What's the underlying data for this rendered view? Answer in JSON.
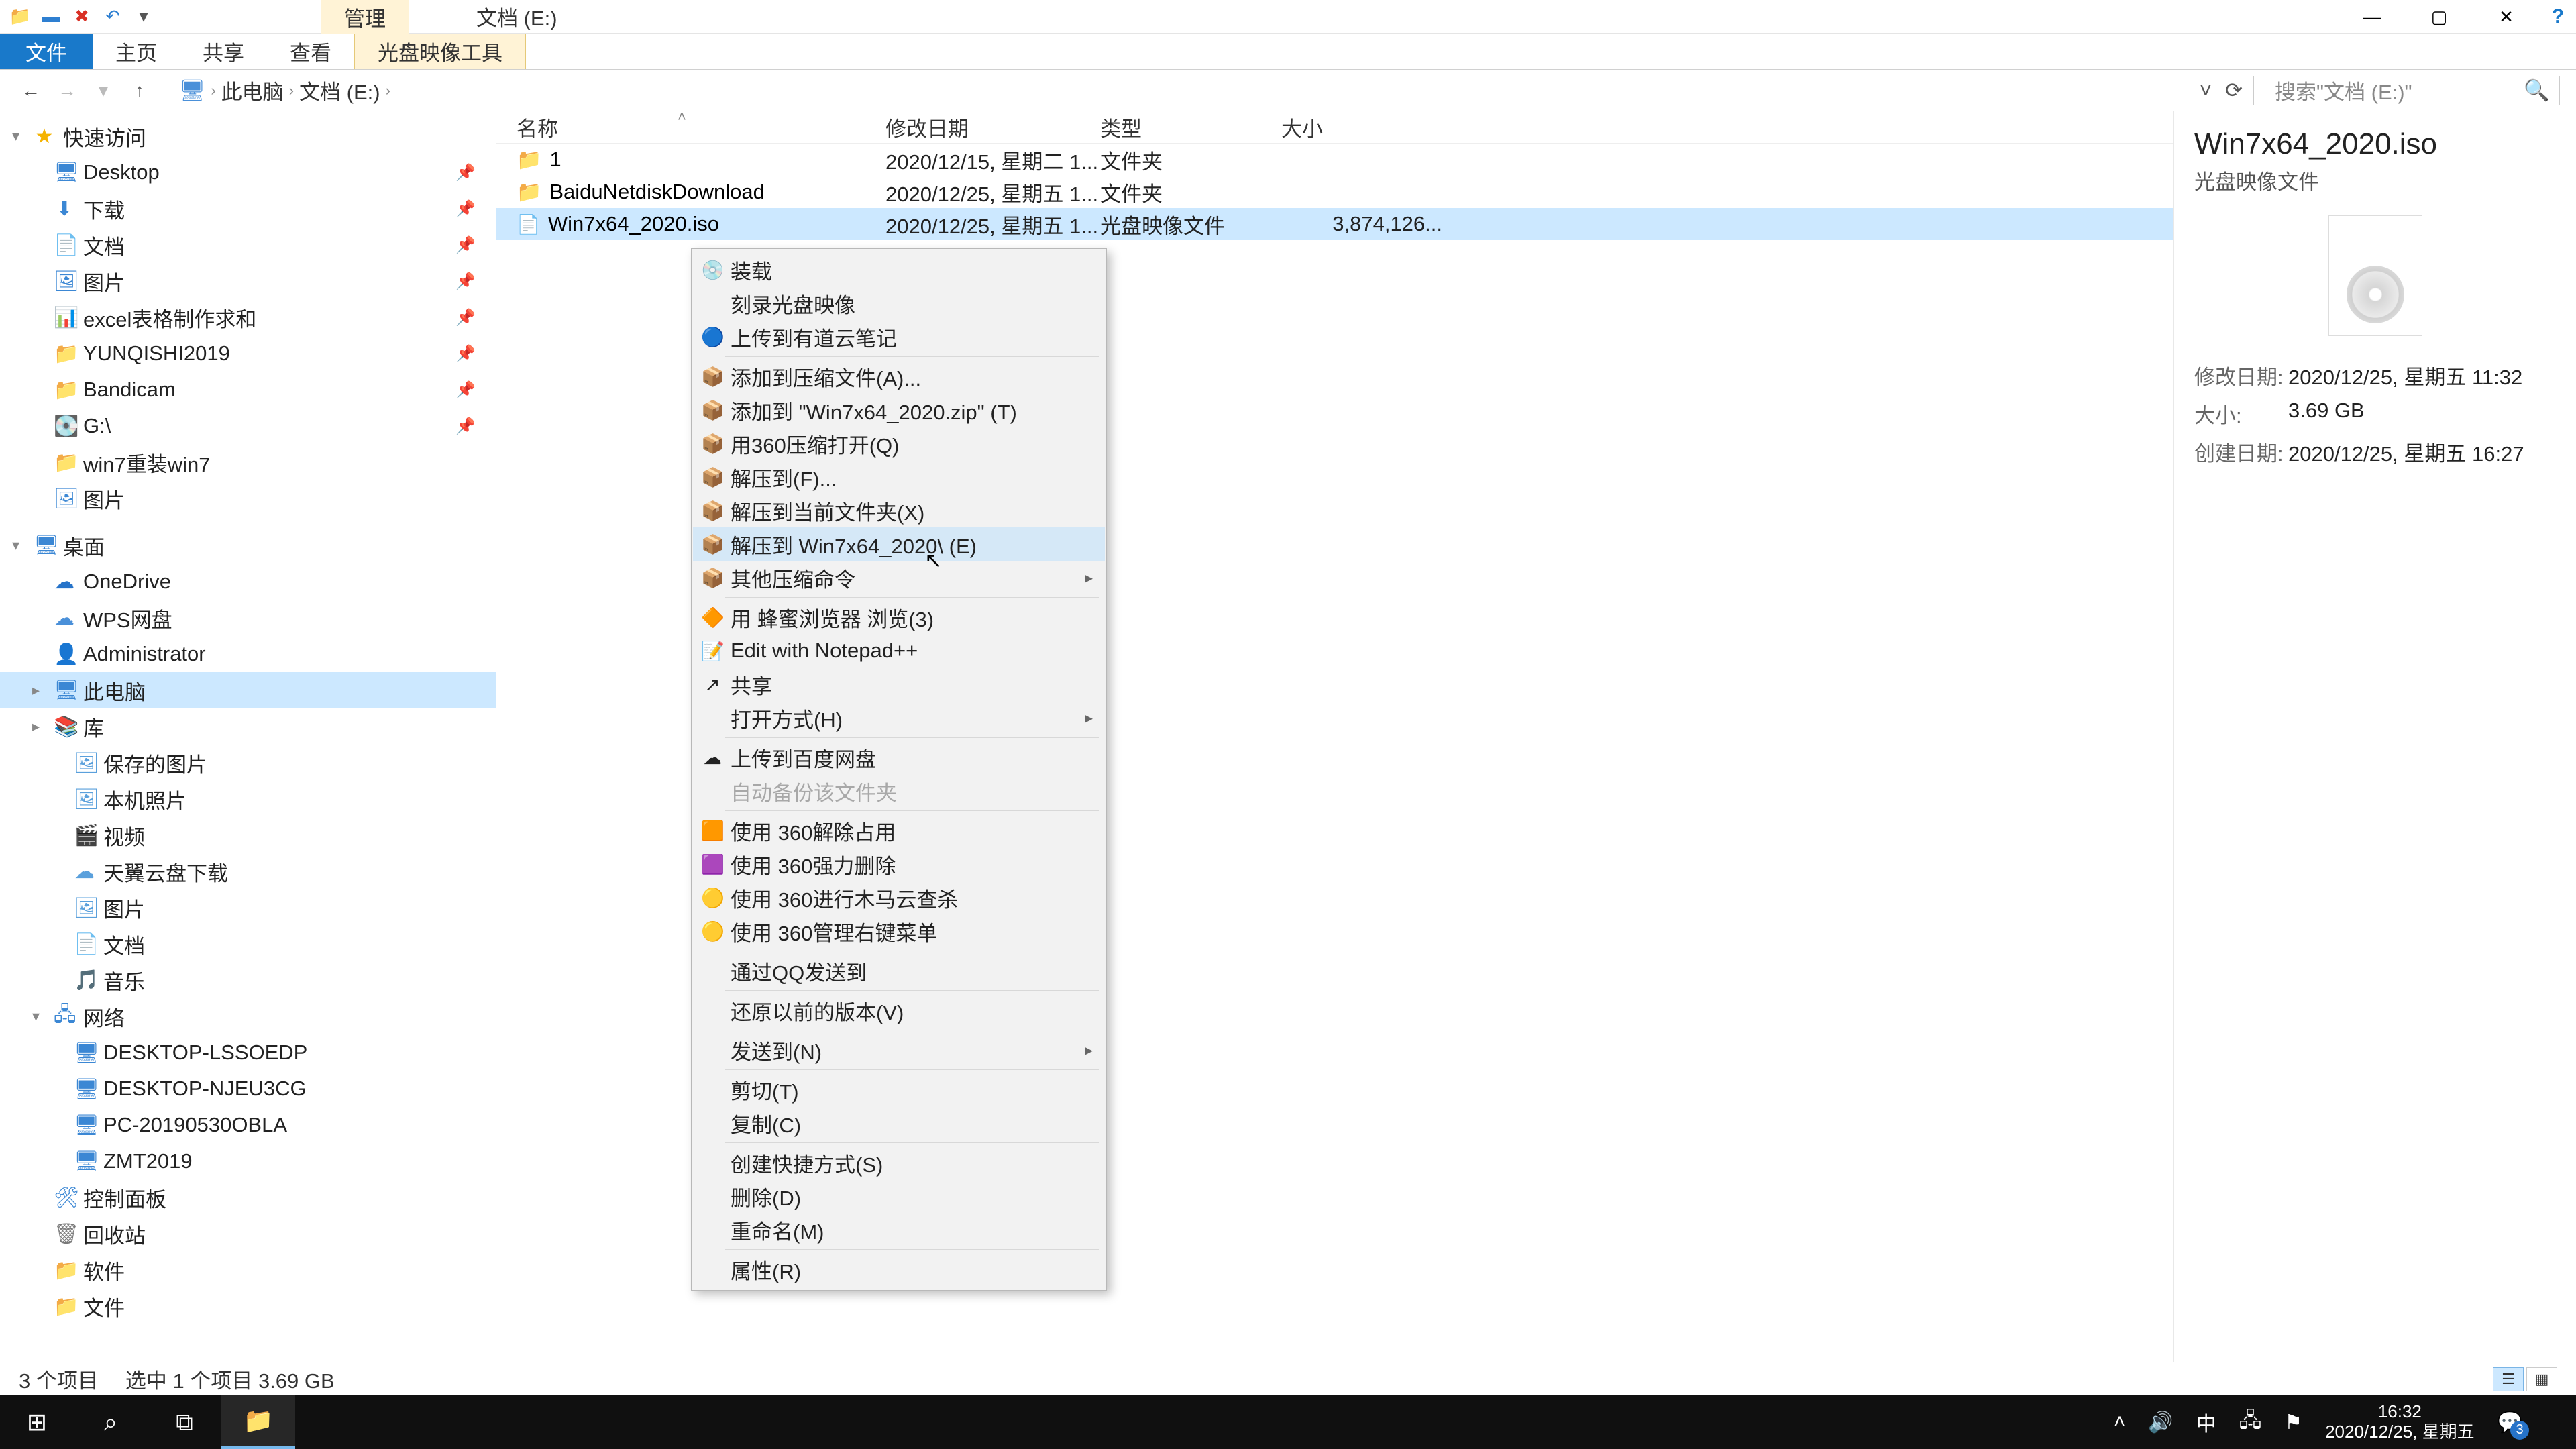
{
  "titlebar": {
    "mgmt": "管理",
    "title": "文档 (E:)"
  },
  "ribbon": {
    "file": "文件",
    "home": "主页",
    "share": "共享",
    "view": "查看",
    "tool": "光盘映像工具"
  },
  "nav": {
    "root": "此电脑",
    "loc": "文档 (E:)",
    "search_placeholder": "搜索\"文档 (E:)\""
  },
  "columns": {
    "name": "名称",
    "date": "修改日期",
    "type": "类型",
    "size": "大小"
  },
  "rows": [
    {
      "name": "1",
      "date": "2020/12/15, 星期二 1...",
      "type": "文件夹",
      "size": "",
      "icon": "folder"
    },
    {
      "name": "BaiduNetdiskDownload",
      "date": "2020/12/25, 星期五 1...",
      "type": "文件夹",
      "size": "",
      "icon": "folder"
    },
    {
      "name": "Win7x64_2020.iso",
      "date": "2020/12/25, 星期五 1...",
      "type": "光盘映像文件",
      "size": "3,874,126...",
      "icon": "file",
      "selected": true
    }
  ],
  "tree": {
    "quick": "快速访问",
    "items_quick": [
      "Desktop",
      "下载",
      "文档",
      "图片",
      "excel表格制作求和",
      "YUNQISHI2019",
      "Bandicam",
      "G:\\",
      "win7重装win7",
      "图片"
    ],
    "desktop": "桌面",
    "items_desktop": [
      "OneDrive",
      "WPS网盘",
      "Administrator",
      "此电脑",
      "库"
    ],
    "lib_items": [
      "保存的图片",
      "本机照片",
      "视频",
      "天翼云盘下载",
      "图片",
      "文档",
      "音乐"
    ],
    "network": "网络",
    "net_items": [
      "DESKTOP-LSSOEDP",
      "DESKTOP-NJEU3CG",
      "PC-20190530OBLA",
      "ZMT2019"
    ],
    "cp": "控制面板",
    "rb": "回收站",
    "sw": "软件",
    "fj": "文件"
  },
  "ctx": [
    {
      "t": "装载",
      "i": "💿"
    },
    {
      "t": "刻录光盘映像",
      "i": ""
    },
    {
      "t": "上传到有道云笔记",
      "i": "🔵"
    },
    "sep",
    {
      "t": "添加到压缩文件(A)...",
      "i": "📦"
    },
    {
      "t": "添加到 \"Win7x64_2020.zip\" (T)",
      "i": "📦"
    },
    {
      "t": "用360压缩打开(Q)",
      "i": "📦"
    },
    {
      "t": "解压到(F)...",
      "i": "📦"
    },
    {
      "t": "解压到当前文件夹(X)",
      "i": "📦"
    },
    {
      "t": "解压到 Win7x64_2020\\ (E)",
      "i": "📦",
      "hov": true
    },
    {
      "t": "其他压缩命令",
      "i": "📦",
      "sub": true
    },
    "sep",
    {
      "t": "用 蜂蜜浏览器 浏览(3)",
      "i": "🔶"
    },
    {
      "t": "Edit with Notepad++",
      "i": "📝"
    },
    {
      "t": "共享",
      "i": "↗"
    },
    {
      "t": "打开方式(H)",
      "i": "",
      "sub": true
    },
    "sep",
    {
      "t": "上传到百度网盘",
      "i": "☁"
    },
    {
      "t": "自动备份该文件夹",
      "i": "",
      "dis": true
    },
    "sep",
    {
      "t": "使用 360解除占用",
      "i": "🟧"
    },
    {
      "t": "使用 360强力删除",
      "i": "🟪"
    },
    {
      "t": "使用 360进行木马云查杀",
      "i": "🟡"
    },
    {
      "t": "使用 360管理右键菜单",
      "i": "🟡"
    },
    "sep",
    {
      "t": "通过QQ发送到",
      "i": ""
    },
    "sep",
    {
      "t": "还原以前的版本(V)",
      "i": ""
    },
    "sep",
    {
      "t": "发送到(N)",
      "i": "",
      "sub": true
    },
    "sep",
    {
      "t": "剪切(T)",
      "i": ""
    },
    {
      "t": "复制(C)",
      "i": ""
    },
    "sep",
    {
      "t": "创建快捷方式(S)",
      "i": ""
    },
    {
      "t": "删除(D)",
      "i": ""
    },
    {
      "t": "重命名(M)",
      "i": ""
    },
    "sep",
    {
      "t": "属性(R)",
      "i": ""
    }
  ],
  "details": {
    "title": "Win7x64_2020.iso",
    "subtitle": "光盘映像文件",
    "mdate_k": "修改日期:",
    "mdate_v": "2020/12/25, 星期五 11:32",
    "size_k": "大小:",
    "size_v": "3.69 GB",
    "cdate_k": "创建日期:",
    "cdate_v": "2020/12/25, 星期五 16:27"
  },
  "status": {
    "count": "3 个项目",
    "sel": "选中 1 个项目  3.69 GB"
  },
  "taskbar": {
    "time": "16:32",
    "date": "2020/12/25, 星期五",
    "ime": "中"
  }
}
